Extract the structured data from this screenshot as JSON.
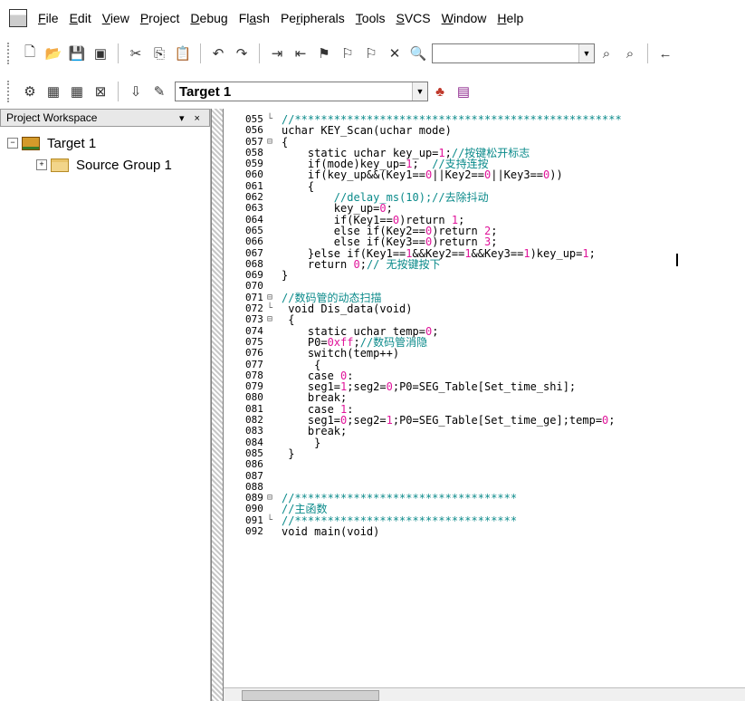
{
  "menu": {
    "items": [
      {
        "pre": "",
        "u": "F",
        "post": "ile"
      },
      {
        "pre": "",
        "u": "E",
        "post": "dit"
      },
      {
        "pre": "",
        "u": "V",
        "post": "iew"
      },
      {
        "pre": "",
        "u": "P",
        "post": "roject"
      },
      {
        "pre": "",
        "u": "D",
        "post": "ebug"
      },
      {
        "pre": "Fl",
        "u": "a",
        "post": "sh"
      },
      {
        "pre": "Pe",
        "u": "r",
        "post": "ipherals"
      },
      {
        "pre": "",
        "u": "T",
        "post": "ools"
      },
      {
        "pre": "",
        "u": "S",
        "post": "VCS"
      },
      {
        "pre": "",
        "u": "W",
        "post": "indow"
      },
      {
        "pre": "",
        "u": "H",
        "post": "elp"
      }
    ]
  },
  "toolbar": {
    "find_value": "",
    "target_value": "Target 1"
  },
  "workspace": {
    "title": "Project Workspace",
    "controls": "▾ ×",
    "tree": [
      {
        "label": "Target 1",
        "expander": "−",
        "indent": 8
      },
      {
        "label": "Source Group 1",
        "expander": "+",
        "indent": 40
      }
    ]
  },
  "editor": {
    "lines": [
      {
        "n": "055",
        "f": "└",
        "c": "<span class='cmt'>//**************************************************</span>"
      },
      {
        "n": "056",
        "f": "",
        "c": "uchar KEY_Scan(uchar mode)"
      },
      {
        "n": "057",
        "f": "⊟",
        "c": "{"
      },
      {
        "n": "058",
        "f": "",
        "c": "    static uchar key_up=<span class='num-lit'>1</span>;<span class='cmt'>//按键松开标志</span>"
      },
      {
        "n": "059",
        "f": "",
        "c": "    if(mode)key_up=<span class='num-lit'>1</span>;  <span class='cmt'>//支持连按</span>"
      },
      {
        "n": "060",
        "f": "",
        "c": "    if(key_up&amp;&amp;(Key1==<span class='num-lit'>0</span>||Key2==<span class='num-lit'>0</span>||Key3==<span class='num-lit'>0</span>))"
      },
      {
        "n": "061",
        "f": "",
        "c": "    {"
      },
      {
        "n": "062",
        "f": "",
        "c": "        <span class='cmt'>//delay_ms(10);//去除抖动</span>"
      },
      {
        "n": "063",
        "f": "",
        "c": "        key_up=<span class='num-lit'>0</span>;"
      },
      {
        "n": "064",
        "f": "",
        "c": "        if(Key1==<span class='num-lit'>0</span>)return <span class='num-lit'>1</span>;"
      },
      {
        "n": "065",
        "f": "",
        "c": "        else if(Key2==<span class='num-lit'>0</span>)return <span class='num-lit'>2</span>;"
      },
      {
        "n": "066",
        "f": "",
        "c": "        else if(Key3==<span class='num-lit'>0</span>)return <span class='num-lit'>3</span>;"
      },
      {
        "n": "067",
        "f": "",
        "c": "    }else if(Key1==<span class='num-lit'>1</span>&amp;&amp;Key2==<span class='num-lit'>1</span>&amp;&amp;Key3==<span class='num-lit'>1</span>)key_up=<span class='num-lit'>1</span>;"
      },
      {
        "n": "068",
        "f": "",
        "c": "    return <span class='num-lit'>0</span>;<span class='cmt'>// 无按键按下</span>"
      },
      {
        "n": "069",
        "f": "",
        "c": "}"
      },
      {
        "n": "070",
        "f": "",
        "c": ""
      },
      {
        "n": "071",
        "f": "⊟",
        "c": "<span class='cmt'>//数码管的动态扫描</span>"
      },
      {
        "n": "072",
        "f": "└",
        "c": " void Dis_data(void)"
      },
      {
        "n": "073",
        "f": "⊟",
        "c": " {"
      },
      {
        "n": "074",
        "f": "",
        "c": "    static uchar temp=<span class='num-lit'>0</span>;"
      },
      {
        "n": "075",
        "f": "",
        "c": "    P0=<span class='num-lit'>0xff</span>;<span class='cmt'>//数码管消隐</span>"
      },
      {
        "n": "076",
        "f": "",
        "c": "    switch(temp++)"
      },
      {
        "n": "077",
        "f": "",
        "c": "     {"
      },
      {
        "n": "078",
        "f": "",
        "c": "    case <span class='num-lit'>0</span>:"
      },
      {
        "n": "079",
        "f": "",
        "c": "    seg1=<span class='num-lit'>1</span>;seg2=<span class='num-lit'>0</span>;P0=SEG_Table[Set_time_shi];"
      },
      {
        "n": "080",
        "f": "",
        "c": "    break;"
      },
      {
        "n": "081",
        "f": "",
        "c": "    case <span class='num-lit'>1</span>:"
      },
      {
        "n": "082",
        "f": "",
        "c": "    seg1=<span class='num-lit'>0</span>;seg2=<span class='num-lit'>1</span>;P0=SEG_Table[Set_time_ge];temp=<span class='num-lit'>0</span>;"
      },
      {
        "n": "083",
        "f": "",
        "c": "    break;"
      },
      {
        "n": "084",
        "f": "",
        "c": "     }"
      },
      {
        "n": "085",
        "f": "",
        "c": " }"
      },
      {
        "n": "086",
        "f": "",
        "c": ""
      },
      {
        "n": "087",
        "f": "",
        "c": ""
      },
      {
        "n": "088",
        "f": "",
        "c": ""
      },
      {
        "n": "089",
        "f": "⊟",
        "c": "<span class='cmt'>//**********************************</span>"
      },
      {
        "n": "090",
        "f": "",
        "c": "<span class='cmt'>//主函数</span>"
      },
      {
        "n": "091",
        "f": "└",
        "c": "<span class='cmt'>//**********************************</span>"
      },
      {
        "n": "092",
        "f": "",
        "c": "void main(void)"
      }
    ]
  }
}
